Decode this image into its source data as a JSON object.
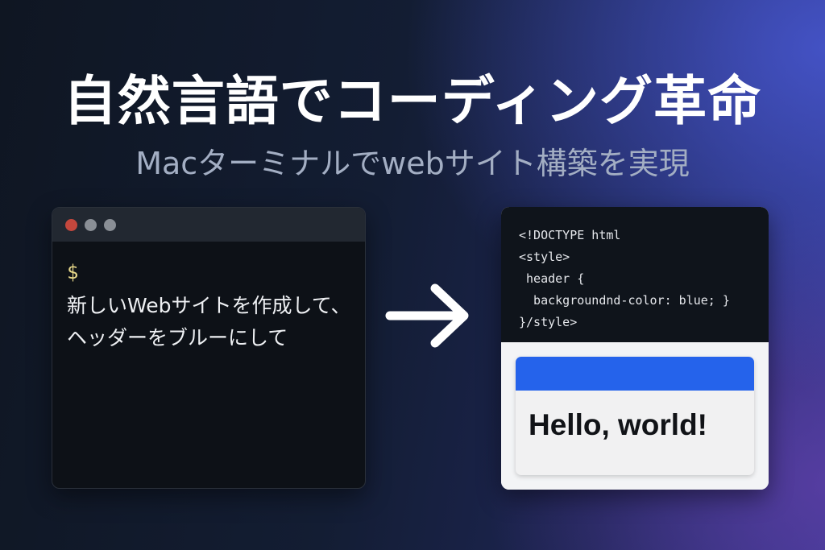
{
  "title": "自然言語でコーディング革命",
  "subtitle": "Macターミナルでwebサイト構築を実現",
  "terminal": {
    "prompt": "$",
    "command_lines": [
      "新しいWebサイトを作成して、",
      "ヘッダーをブルーにして"
    ]
  },
  "code": {
    "lines": [
      "<!DOCTYPE html",
      "<style>",
      " header {",
      "  backgroundnd-color: blue; }",
      "}/style>"
    ]
  },
  "preview": {
    "heading": "Hello, world!",
    "header_color": "#2563eb"
  },
  "colors": {
    "terminal_bg": "#0d1117",
    "close_dot": "#c4473d",
    "prompt": "#e8d98a"
  },
  "icons": [
    "arrow-right-icon"
  ]
}
